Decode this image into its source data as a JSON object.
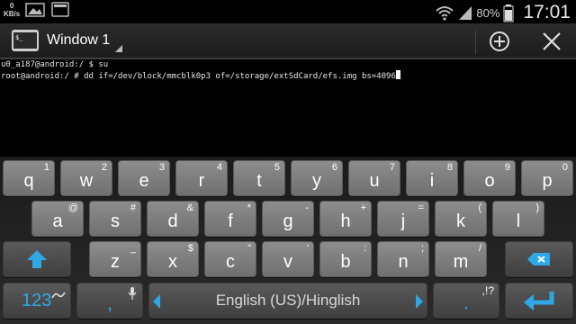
{
  "status_bar": {
    "net_speed_value": "0",
    "net_speed_unit": "KB/s",
    "battery_percent": "80%",
    "time": "17:01",
    "icons": [
      "gallery-icon",
      "screenshot-icon",
      "wifi-icon",
      "signal-icon",
      "battery-icon"
    ]
  },
  "action_bar": {
    "window_title": "Window 1",
    "icons": [
      "terminal-app-icon",
      "add-window-icon",
      "close-window-icon"
    ]
  },
  "terminal": {
    "lines": [
      "u0_a187@android:/ $ su",
      "root@android:/ # dd if=/dev/block/mmcblk0p3 of=/storage/extSdCard/efs.img bs=4096"
    ]
  },
  "keyboard": {
    "row1": [
      {
        "main": "q",
        "sub": "1"
      },
      {
        "main": "w",
        "sub": "2"
      },
      {
        "main": "e",
        "sub": "3"
      },
      {
        "main": "r",
        "sub": "4"
      },
      {
        "main": "t",
        "sub": "5"
      },
      {
        "main": "y",
        "sub": "6"
      },
      {
        "main": "u",
        "sub": "7"
      },
      {
        "main": "i",
        "sub": "8"
      },
      {
        "main": "o",
        "sub": "9"
      },
      {
        "main": "p",
        "sub": "0"
      }
    ],
    "row2": [
      {
        "main": "a",
        "sub": "@"
      },
      {
        "main": "s",
        "sub": "#"
      },
      {
        "main": "d",
        "sub": "&"
      },
      {
        "main": "f",
        "sub": "*"
      },
      {
        "main": "g",
        "sub": "-"
      },
      {
        "main": "h",
        "sub": "+"
      },
      {
        "main": "j",
        "sub": "="
      },
      {
        "main": "k",
        "sub": "("
      },
      {
        "main": "l",
        "sub": ")"
      }
    ],
    "row3": [
      {
        "main": "z",
        "sub": "_"
      },
      {
        "main": "x",
        "sub": "$"
      },
      {
        "main": "c",
        "sub": "\""
      },
      {
        "main": "v",
        "sub": "'"
      },
      {
        "main": "b",
        "sub": ":"
      },
      {
        "main": "n",
        "sub": ";"
      },
      {
        "main": "m",
        "sub": "/"
      }
    ],
    "numbers_label": "123",
    "comma_label": ",",
    "language_label": "English (US)/Hinglish",
    "period_label": ".",
    "period_sub": ",!?",
    "accent_color": "#2fa8e6",
    "icons": [
      "shift-icon",
      "backspace-icon",
      "swype-icon",
      "mic-icon",
      "left-arrow-icon",
      "right-arrow-icon",
      "enter-icon"
    ]
  }
}
